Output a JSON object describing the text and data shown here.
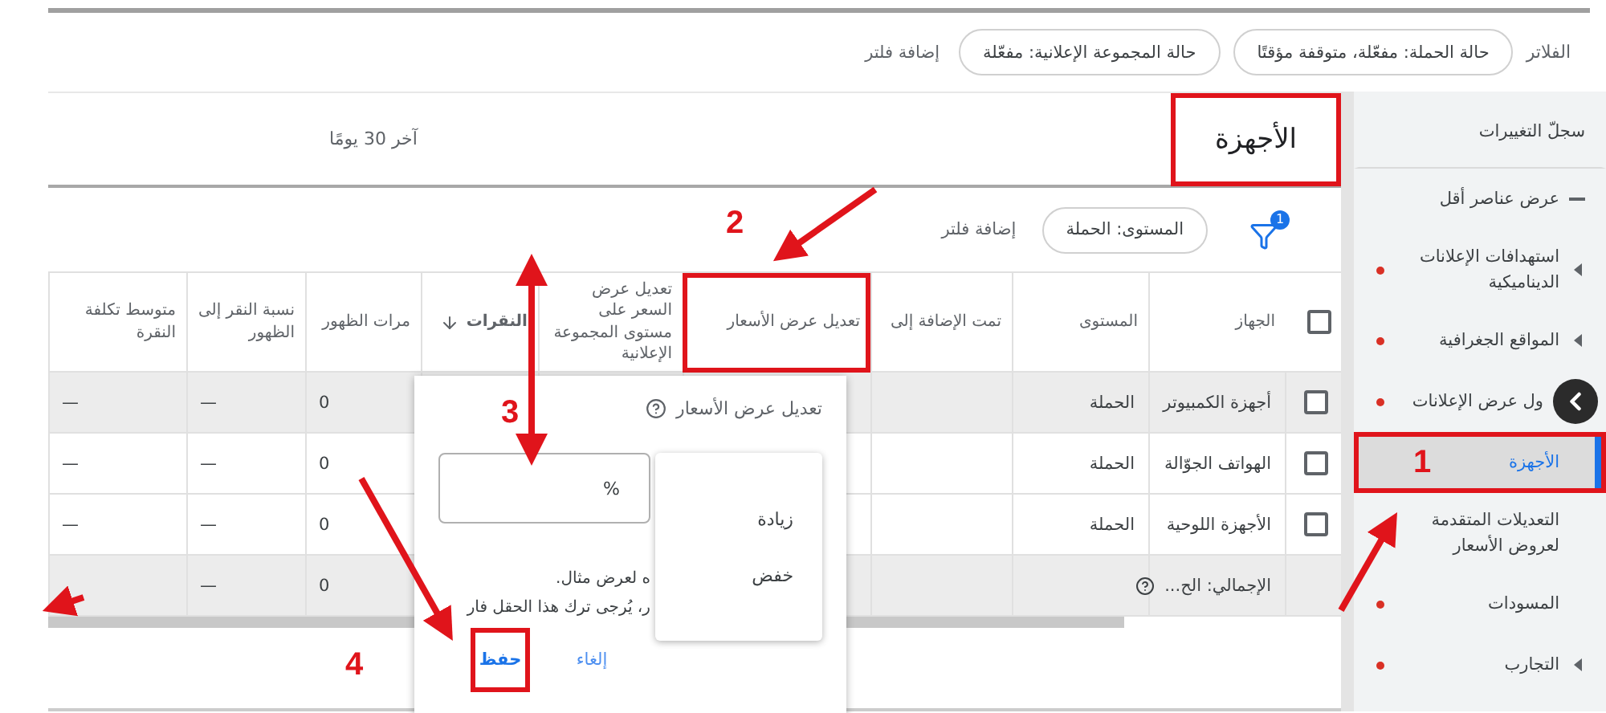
{
  "filters": {
    "label": "الفلاتر",
    "chips": [
      "حالة الحملة: مفعّلة، متوقفة مؤقتًا",
      "حالة المجموعة الإعلانية: مفعّلة"
    ],
    "add_filter": "إضافة فلتر"
  },
  "sidebar": {
    "items": [
      {
        "kind": "link",
        "label": "سجلّ التغييرات",
        "selected": false,
        "annotated": false
      },
      {
        "kind": "toggle",
        "label": "عرض عناصر أقل",
        "selected": false,
        "annotated": false
      },
      {
        "kind": "item",
        "label": "استهدافات الإعلانات الديناميكية",
        "expandable": true,
        "dot": true,
        "selected": false,
        "annotated": false
      },
      {
        "kind": "item",
        "label": "المواقع الجغرافية",
        "expandable": true,
        "dot": true,
        "selected": false,
        "annotated": false
      },
      {
        "kind": "under_button",
        "label": "ول عرض الإعلانات",
        "dot": true,
        "selected": false,
        "annotated": false
      },
      {
        "kind": "item",
        "label": "الأجهزة",
        "expandable": false,
        "dot": false,
        "selected": true,
        "annotated": true
      },
      {
        "kind": "item",
        "label": "التعديلات المتقدمة لعروض الأسعار",
        "expandable": false,
        "selected": false,
        "annotated": false
      },
      {
        "kind": "item",
        "label": "المسودات",
        "expandable": false,
        "dot": true,
        "selected": false,
        "annotated": false
      },
      {
        "kind": "item",
        "label": "التجارب",
        "expandable": true,
        "dot": true,
        "selected": false,
        "annotated": false
      }
    ]
  },
  "page": {
    "title": "الأجهزة",
    "title_annotated": true,
    "date_range": "آخر 30 يومًا"
  },
  "toolbar": {
    "filter_count": "1",
    "chips": [
      "المستوى: الحملة"
    ],
    "add_filter": "إضافة فلتر"
  },
  "table": {
    "select_all_checked": false,
    "columns": [
      {
        "label": "الجهاز",
        "sorted": false,
        "annotated": false
      },
      {
        "label": "المستوى",
        "sorted": false,
        "annotated": false
      },
      {
        "label": "تمت الإضافة إلى",
        "sorted": false,
        "annotated": false
      },
      {
        "label": "تعديل عرض الأسعار",
        "sorted": false,
        "annotated": true
      },
      {
        "label": "تعديل عرض السعر على مستوى المجموعة الإعلانية",
        "sorted": false,
        "annotated": false
      },
      {
        "label": "النقرات",
        "sorted": true,
        "annotated": false
      },
      {
        "label": "مرات الظهور",
        "sorted": false,
        "annotated": false
      },
      {
        "label": "نسبة النقر إلى الظهور",
        "sorted": false,
        "annotated": false
      },
      {
        "label": "متوسط تكلفة النقرة",
        "sorted": false,
        "annotated": false
      }
    ],
    "rows": [
      {
        "checked": false,
        "highlighted": true,
        "device": "أجهزة الكمبيوتر",
        "level": "الحملة",
        "impressions": "0",
        "ctr": "—",
        "avg_cpc": "—"
      },
      {
        "checked": false,
        "highlighted": false,
        "device": "الهواتف الجوّالة",
        "level": "الحملة",
        "impressions": "0",
        "ctr": "—",
        "avg_cpc": "—"
      },
      {
        "checked": false,
        "highlighted": false,
        "device": "الأجهزة اللوحية",
        "level": "الحملة",
        "impressions": "0",
        "ctr": "—",
        "avg_cpc": "—"
      }
    ],
    "total": {
      "label": "الإجمالي: الح...",
      "impressions": "0",
      "ctr": "—"
    }
  },
  "popup": {
    "title": "تعديل عرض الأسعار",
    "menu": [
      "زيادة",
      "خفض"
    ],
    "input": {
      "suffix": "%"
    },
    "hint_lines": [
      "ه لعرض مثال.",
      "ر، يُرجى ترك هذا الحقل فار"
    ],
    "buttons": [
      {
        "kind": "cancel",
        "label": "إلغاء",
        "annotated": false
      },
      {
        "kind": "save",
        "label": "حفظ",
        "annotated": true
      }
    ]
  },
  "annotations": {
    "steps": [
      "1",
      "2",
      "3",
      "4"
    ]
  }
}
